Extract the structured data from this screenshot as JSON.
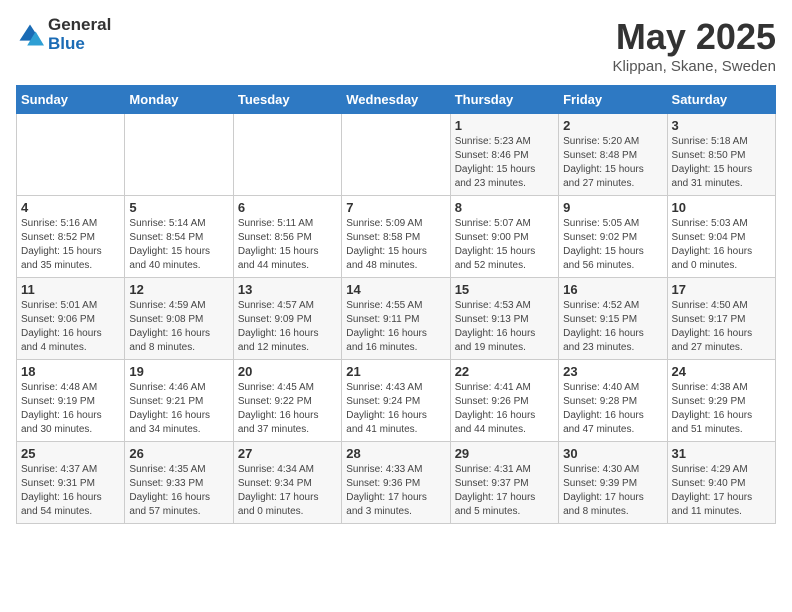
{
  "logo": {
    "general": "General",
    "blue": "Blue"
  },
  "title": "May 2025",
  "location": "Klippan, Skane, Sweden",
  "days_header": [
    "Sunday",
    "Monday",
    "Tuesday",
    "Wednesday",
    "Thursday",
    "Friday",
    "Saturday"
  ],
  "weeks": [
    [
      {
        "day": "",
        "info": ""
      },
      {
        "day": "",
        "info": ""
      },
      {
        "day": "",
        "info": ""
      },
      {
        "day": "",
        "info": ""
      },
      {
        "day": "1",
        "info": "Sunrise: 5:23 AM\nSunset: 8:46 PM\nDaylight: 15 hours\nand 23 minutes."
      },
      {
        "day": "2",
        "info": "Sunrise: 5:20 AM\nSunset: 8:48 PM\nDaylight: 15 hours\nand 27 minutes."
      },
      {
        "day": "3",
        "info": "Sunrise: 5:18 AM\nSunset: 8:50 PM\nDaylight: 15 hours\nand 31 minutes."
      }
    ],
    [
      {
        "day": "4",
        "info": "Sunrise: 5:16 AM\nSunset: 8:52 PM\nDaylight: 15 hours\nand 35 minutes."
      },
      {
        "day": "5",
        "info": "Sunrise: 5:14 AM\nSunset: 8:54 PM\nDaylight: 15 hours\nand 40 minutes."
      },
      {
        "day": "6",
        "info": "Sunrise: 5:11 AM\nSunset: 8:56 PM\nDaylight: 15 hours\nand 44 minutes."
      },
      {
        "day": "7",
        "info": "Sunrise: 5:09 AM\nSunset: 8:58 PM\nDaylight: 15 hours\nand 48 minutes."
      },
      {
        "day": "8",
        "info": "Sunrise: 5:07 AM\nSunset: 9:00 PM\nDaylight: 15 hours\nand 52 minutes."
      },
      {
        "day": "9",
        "info": "Sunrise: 5:05 AM\nSunset: 9:02 PM\nDaylight: 15 hours\nand 56 minutes."
      },
      {
        "day": "10",
        "info": "Sunrise: 5:03 AM\nSunset: 9:04 PM\nDaylight: 16 hours\nand 0 minutes."
      }
    ],
    [
      {
        "day": "11",
        "info": "Sunrise: 5:01 AM\nSunset: 9:06 PM\nDaylight: 16 hours\nand 4 minutes."
      },
      {
        "day": "12",
        "info": "Sunrise: 4:59 AM\nSunset: 9:08 PM\nDaylight: 16 hours\nand 8 minutes."
      },
      {
        "day": "13",
        "info": "Sunrise: 4:57 AM\nSunset: 9:09 PM\nDaylight: 16 hours\nand 12 minutes."
      },
      {
        "day": "14",
        "info": "Sunrise: 4:55 AM\nSunset: 9:11 PM\nDaylight: 16 hours\nand 16 minutes."
      },
      {
        "day": "15",
        "info": "Sunrise: 4:53 AM\nSunset: 9:13 PM\nDaylight: 16 hours\nand 19 minutes."
      },
      {
        "day": "16",
        "info": "Sunrise: 4:52 AM\nSunset: 9:15 PM\nDaylight: 16 hours\nand 23 minutes."
      },
      {
        "day": "17",
        "info": "Sunrise: 4:50 AM\nSunset: 9:17 PM\nDaylight: 16 hours\nand 27 minutes."
      }
    ],
    [
      {
        "day": "18",
        "info": "Sunrise: 4:48 AM\nSunset: 9:19 PM\nDaylight: 16 hours\nand 30 minutes."
      },
      {
        "day": "19",
        "info": "Sunrise: 4:46 AM\nSunset: 9:21 PM\nDaylight: 16 hours\nand 34 minutes."
      },
      {
        "day": "20",
        "info": "Sunrise: 4:45 AM\nSunset: 9:22 PM\nDaylight: 16 hours\nand 37 minutes."
      },
      {
        "day": "21",
        "info": "Sunrise: 4:43 AM\nSunset: 9:24 PM\nDaylight: 16 hours\nand 41 minutes."
      },
      {
        "day": "22",
        "info": "Sunrise: 4:41 AM\nSunset: 9:26 PM\nDaylight: 16 hours\nand 44 minutes."
      },
      {
        "day": "23",
        "info": "Sunrise: 4:40 AM\nSunset: 9:28 PM\nDaylight: 16 hours\nand 47 minutes."
      },
      {
        "day": "24",
        "info": "Sunrise: 4:38 AM\nSunset: 9:29 PM\nDaylight: 16 hours\nand 51 minutes."
      }
    ],
    [
      {
        "day": "25",
        "info": "Sunrise: 4:37 AM\nSunset: 9:31 PM\nDaylight: 16 hours\nand 54 minutes."
      },
      {
        "day": "26",
        "info": "Sunrise: 4:35 AM\nSunset: 9:33 PM\nDaylight: 16 hours\nand 57 minutes."
      },
      {
        "day": "27",
        "info": "Sunrise: 4:34 AM\nSunset: 9:34 PM\nDaylight: 17 hours\nand 0 minutes."
      },
      {
        "day": "28",
        "info": "Sunrise: 4:33 AM\nSunset: 9:36 PM\nDaylight: 17 hours\nand 3 minutes."
      },
      {
        "day": "29",
        "info": "Sunrise: 4:31 AM\nSunset: 9:37 PM\nDaylight: 17 hours\nand 5 minutes."
      },
      {
        "day": "30",
        "info": "Sunrise: 4:30 AM\nSunset: 9:39 PM\nDaylight: 17 hours\nand 8 minutes."
      },
      {
        "day": "31",
        "info": "Sunrise: 4:29 AM\nSunset: 9:40 PM\nDaylight: 17 hours\nand 11 minutes."
      }
    ]
  ]
}
